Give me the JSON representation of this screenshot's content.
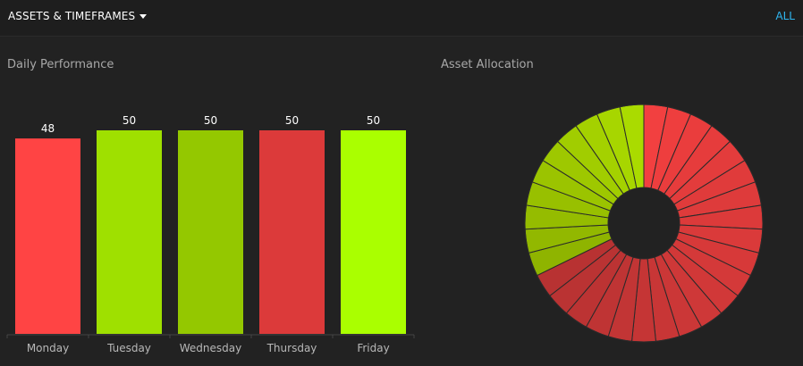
{
  "header": {
    "menu_label": "ASSETS & TIMEFRAMES",
    "all_label": "ALL"
  },
  "colors": {
    "background": "#222222",
    "header_bg": "#1e1e1e",
    "link": "#2fb6f0"
  },
  "chart_data": [
    {
      "type": "bar",
      "title": "Daily Performance",
      "categories": [
        "Monday",
        "Tuesday",
        "Wednesday",
        "Thursday",
        "Friday"
      ],
      "values": [
        48,
        50,
        50,
        50,
        50
      ],
      "colors": [
        "#ff4444",
        "#9fe000",
        "#94c800",
        "#dc3a3a",
        "#aaff00"
      ],
      "ylim": [
        0,
        50
      ],
      "grid": false,
      "show_data_labels": true
    },
    {
      "type": "pie",
      "title": "Asset Allocation",
      "donut": true,
      "slices": [
        {
          "value": 1,
          "color": "#f24040"
        },
        {
          "value": 1,
          "color": "#ee3e3e"
        },
        {
          "value": 1,
          "color": "#ea3d3d"
        },
        {
          "value": 1,
          "color": "#e63c3c"
        },
        {
          "value": 1,
          "color": "#e33c3c"
        },
        {
          "value": 1,
          "color": "#e03b3b"
        },
        {
          "value": 1,
          "color": "#de3b3b"
        },
        {
          "value": 1,
          "color": "#dc3a3a"
        },
        {
          "value": 1,
          "color": "#da3a3a"
        },
        {
          "value": 1,
          "color": "#d73939"
        },
        {
          "value": 1,
          "color": "#d43939"
        },
        {
          "value": 1,
          "color": "#d13838"
        },
        {
          "value": 1,
          "color": "#ce3838"
        },
        {
          "value": 1,
          "color": "#cb3737"
        },
        {
          "value": 1,
          "color": "#c83636"
        },
        {
          "value": 1,
          "color": "#c53535"
        },
        {
          "value": 1,
          "color": "#c23535"
        },
        {
          "value": 1,
          "color": "#bf3434"
        },
        {
          "value": 1,
          "color": "#bc3333"
        },
        {
          "value": 1,
          "color": "#ba3333"
        },
        {
          "value": 1,
          "color": "#b83232"
        },
        {
          "value": 1,
          "color": "#8fb400"
        },
        {
          "value": 1,
          "color": "#92b800"
        },
        {
          "value": 1,
          "color": "#95bc00"
        },
        {
          "value": 1,
          "color": "#98c000"
        },
        {
          "value": 1,
          "color": "#9bc400"
        },
        {
          "value": 1,
          "color": "#9ec800"
        },
        {
          "value": 1,
          "color": "#a1cd00"
        },
        {
          "value": 1,
          "color": "#a4d100"
        },
        {
          "value": 1,
          "color": "#a7d600"
        },
        {
          "value": 1,
          "color": "#aadb00"
        }
      ]
    }
  ]
}
